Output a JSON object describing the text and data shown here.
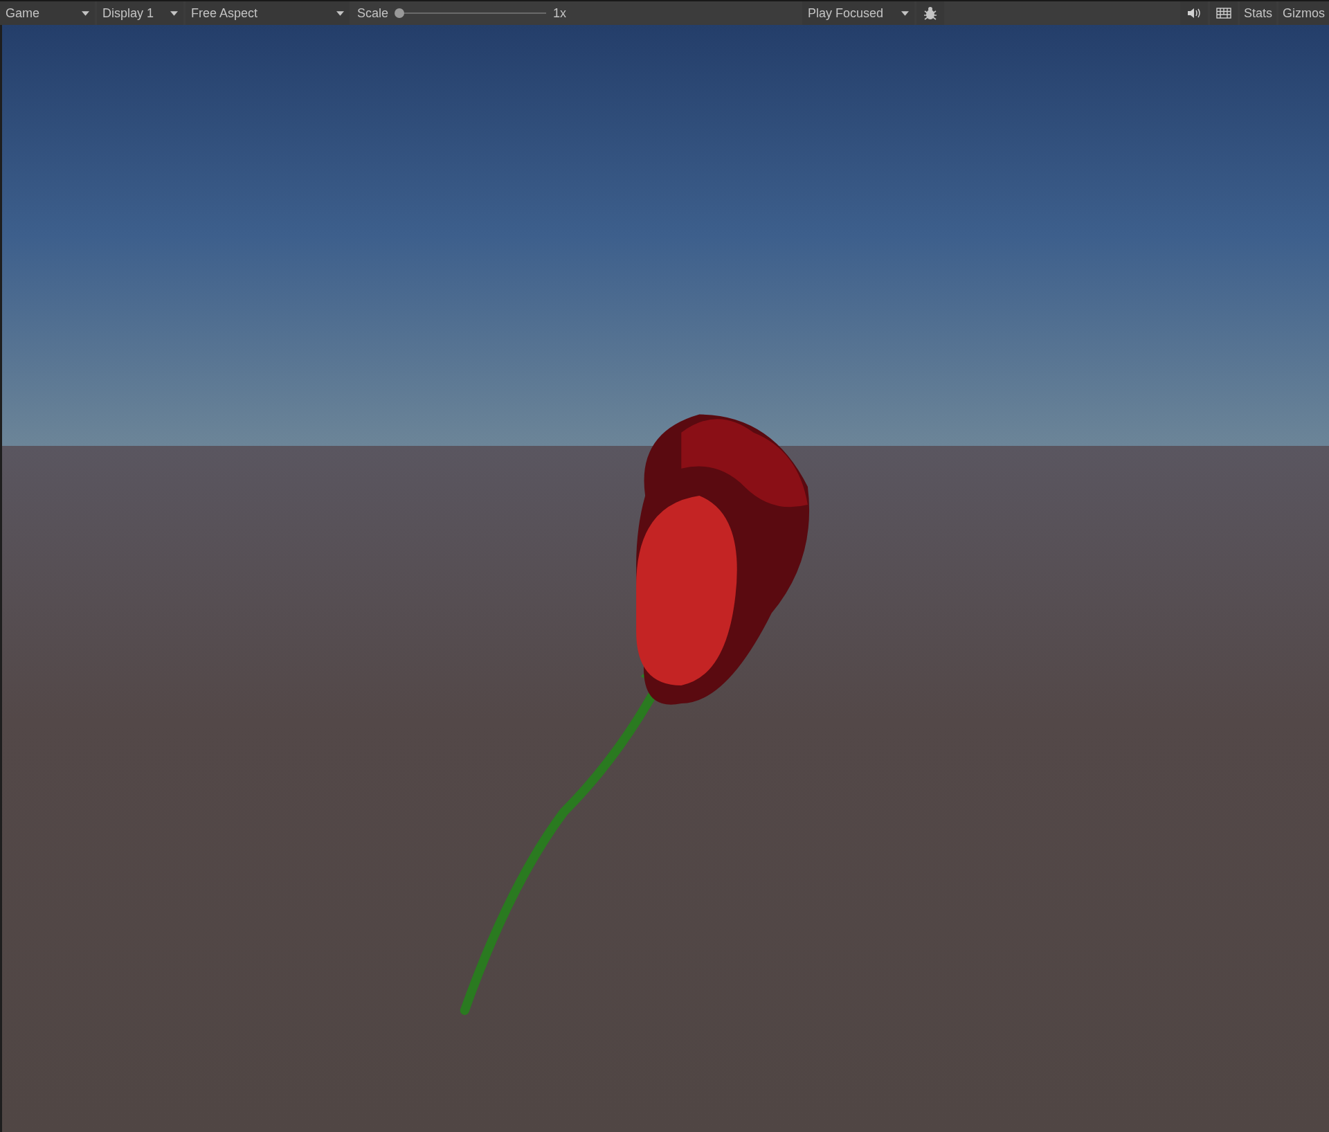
{
  "toolbar": {
    "view": {
      "label": "Game"
    },
    "display": {
      "label": "Display 1"
    },
    "aspect": {
      "label": "Free Aspect"
    },
    "scale": {
      "label": "Scale",
      "level": 0,
      "reading": "1x"
    },
    "play_mode": {
      "label": "Play Focused"
    },
    "stats": {
      "label": "Stats"
    },
    "gizmos": {
      "label": "Gizmos"
    }
  }
}
